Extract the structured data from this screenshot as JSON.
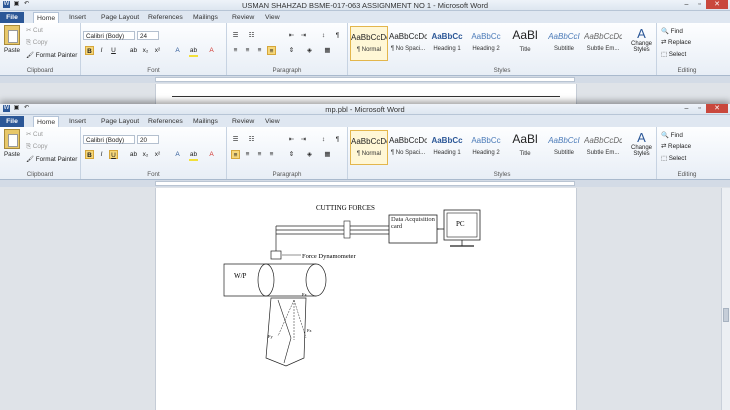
{
  "window_back": {
    "title": "USMAN SHAHZAD BSME-017-063 ASSIGNMENT NO 1 - Microsoft Word",
    "font_name": "Calibri (Body)",
    "font_size": "24"
  },
  "window_front": {
    "title": "mp.pbl - Microsoft Word",
    "font_name": "Calibri (Body)",
    "font_size": "20"
  },
  "tabs": [
    "File",
    "Home",
    "Insert",
    "Page Layout",
    "References",
    "Mailings",
    "Review",
    "View"
  ],
  "clipboard": {
    "paste": "Paste",
    "cut": "Cut",
    "copy": "Copy",
    "format_painter": "Format Painter",
    "group_label": "Clipboard"
  },
  "group_labels": {
    "font": "Font",
    "paragraph": "Paragraph",
    "styles": "Styles",
    "editing": "Editing"
  },
  "styles": [
    {
      "preview": "AaBbCcDc",
      "name": "¶ Normal"
    },
    {
      "preview": "AaBbCcDc",
      "name": "¶ No Spaci..."
    },
    {
      "preview": "AaBbCc",
      "name": "Heading 1"
    },
    {
      "preview": "AaBbCc",
      "name": "Heading 2"
    },
    {
      "preview": "AaBl",
      "name": "Title"
    },
    {
      "preview": "AaBbCcI",
      "name": "Subtitle"
    },
    {
      "preview": "AaBbCcDc",
      "name": "Subtle Em..."
    }
  ],
  "change_styles": "Change Styles",
  "editing": {
    "find": "Find",
    "replace": "Replace",
    "select": "Select"
  },
  "figure": {
    "heading": "CUTTING FORCES",
    "daq": "Data Acquisition card",
    "pc": "PC",
    "dynamometer": "Force Dynamometer",
    "workpiece": "W/P",
    "label_fx": "Fx",
    "label_fy": "Fy",
    "label_fz": "Fz"
  },
  "colors": {
    "file_tab": "#2b5797",
    "close_button": "#c9483d",
    "selected_style": "#e3b64c",
    "font_color_red": "#d0302a",
    "highlight_yellow": "#f2e03a"
  }
}
